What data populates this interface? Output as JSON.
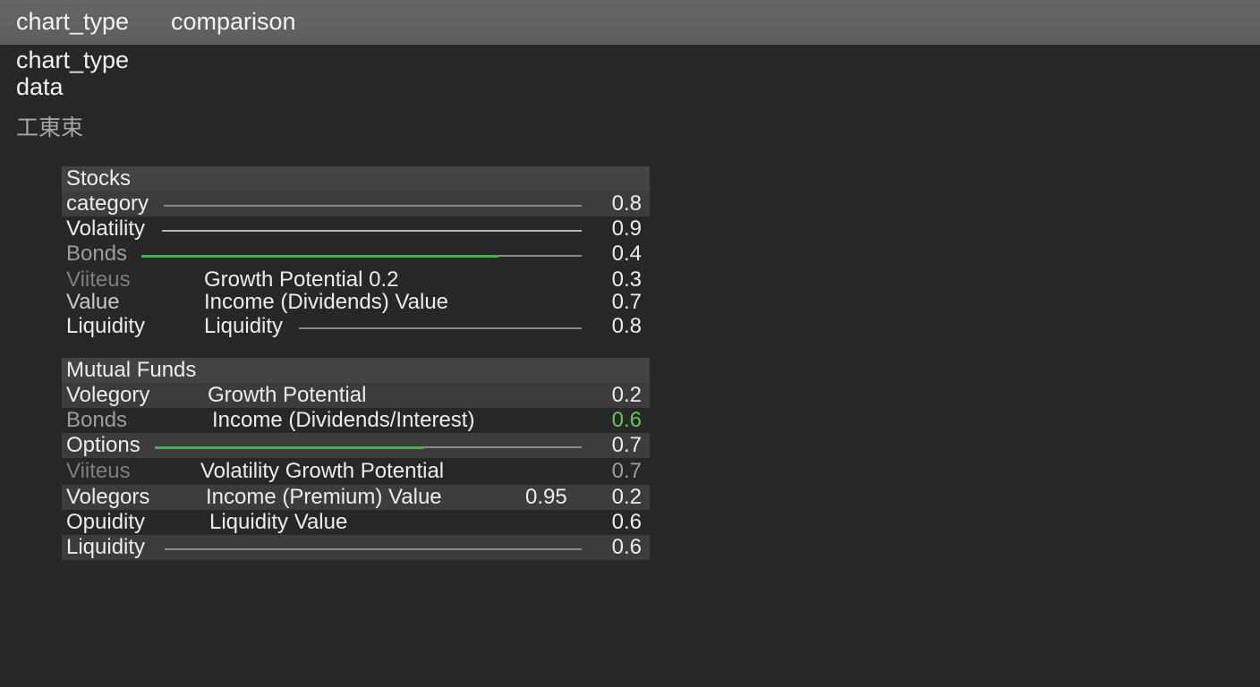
{
  "header": {
    "key": "chart_type",
    "value": "comparison",
    "sub_line_1": "chart_type",
    "sub_line_2": "data",
    "glyphs": "工東束"
  },
  "stocks": {
    "title": "Stocks",
    "rows": [
      {
        "label": "category",
        "mid": "",
        "value": "0.8"
      },
      {
        "label": "Volatility",
        "mid": "",
        "value": "0.9"
      },
      {
        "label": "Bonds",
        "mid": "",
        "value": "0.4",
        "bar_fraction": 0.81
      },
      {
        "label": "Viiteus",
        "mid": "Growth Potential  0.2",
        "value": "0.3"
      },
      {
        "label": "Value",
        "mid": "Income (Dividends) Value",
        "value": "0.7"
      },
      {
        "label": "Liquidity",
        "mid": "Liquidity",
        "value": "0.8"
      }
    ]
  },
  "mutual_funds": {
    "title": "Mutual Funds",
    "rows": [
      {
        "label": "Volegory",
        "mid": "Growth Potential",
        "value": "0.2"
      },
      {
        "label": "Bonds",
        "mid": "Income (Dividends/Interest)",
        "value": "0.6"
      },
      {
        "label": "Options",
        "mid": "",
        "value": "0.7",
        "bar_fraction": 0.63
      },
      {
        "label": "Viiteus",
        "mid": "Volatility Growth Potential",
        "value": "0.7"
      },
      {
        "label": "Volegors",
        "mid": "Income (Premium) Value",
        "extra": "0.95",
        "value": "0.2"
      },
      {
        "label": "Opuidity",
        "mid": "Liquidity Value",
        "value": "0.6"
      },
      {
        "label": "Liquidity",
        "mid": "",
        "value": "0.6"
      }
    ]
  },
  "colors": {
    "background": "#272727",
    "topbar": "#626262",
    "accent_green": "#48b04a",
    "value_green": "#62c85a"
  }
}
